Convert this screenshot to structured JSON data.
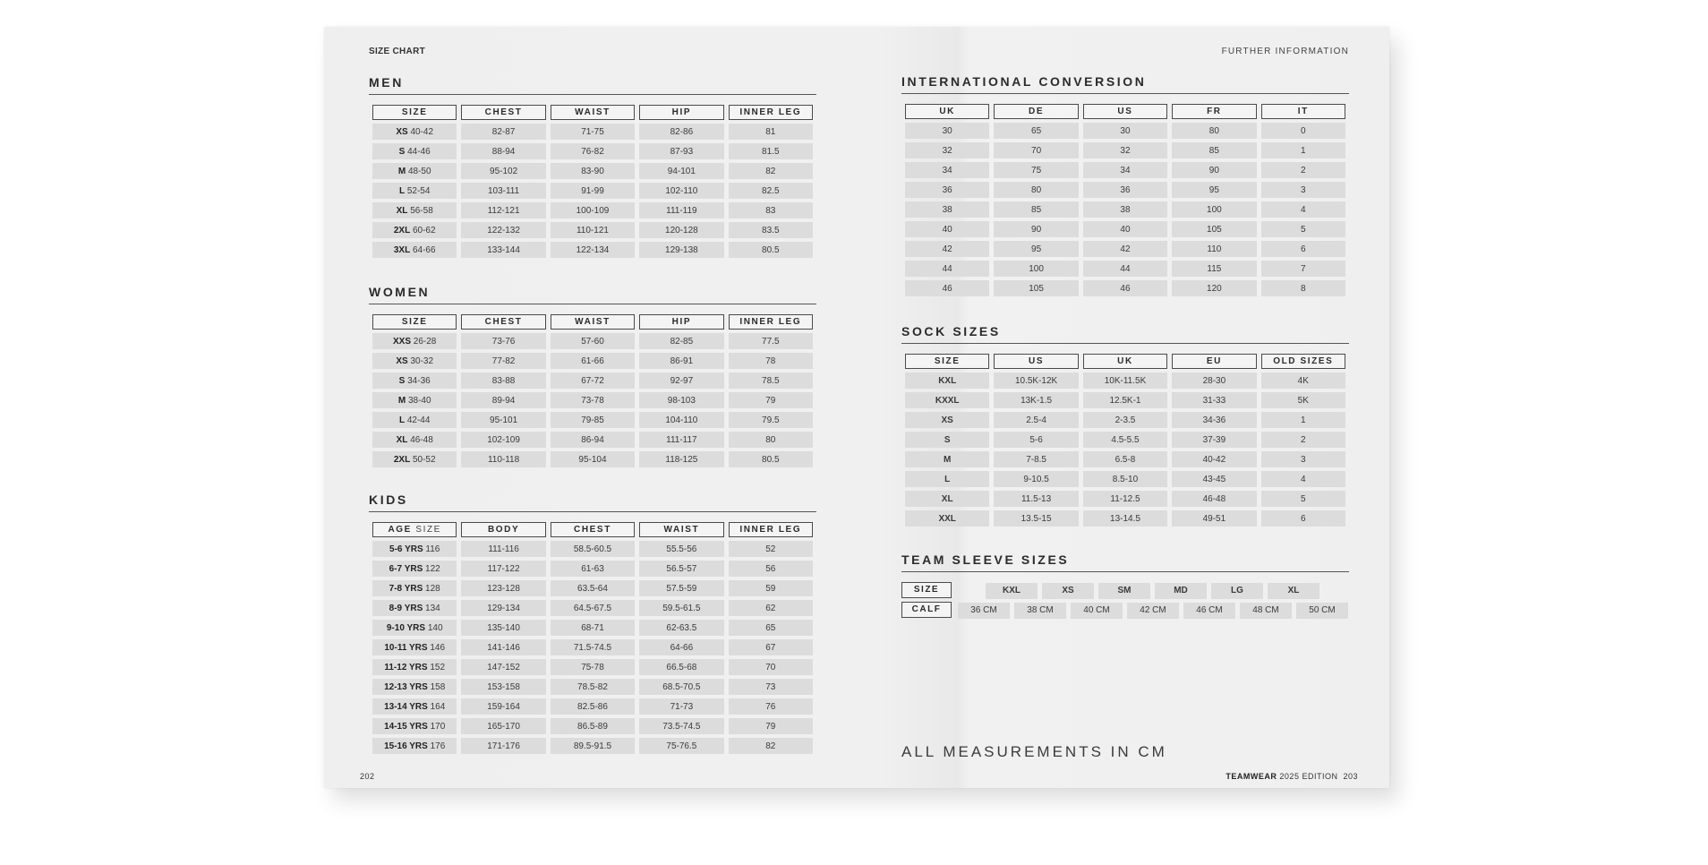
{
  "left_page": {
    "runner": "SIZE CHART",
    "folio": "202",
    "men": {
      "title": "MEN",
      "headers": [
        "SIZE",
        "CHEST",
        "WAIST",
        "HIP",
        "INNER LEG"
      ],
      "rows": [
        [
          "XS",
          "40-42",
          "82-87",
          "71-75",
          "82-86",
          "81"
        ],
        [
          "S",
          "44-46",
          "88-94",
          "76-82",
          "87-93",
          "81.5"
        ],
        [
          "M",
          "48-50",
          "95-102",
          "83-90",
          "94-101",
          "82"
        ],
        [
          "L",
          "52-54",
          "103-111",
          "91-99",
          "102-110",
          "82.5"
        ],
        [
          "XL",
          "56-58",
          "112-121",
          "100-109",
          "111-119",
          "83"
        ],
        [
          "2XL",
          "60-62",
          "122-132",
          "110-121",
          "120-128",
          "83.5"
        ],
        [
          "3XL",
          "64-66",
          "133-144",
          "122-134",
          "129-138",
          "80.5"
        ]
      ]
    },
    "women": {
      "title": "WOMEN",
      "headers": [
        "SIZE",
        "CHEST",
        "WAIST",
        "HIP",
        "INNER LEG"
      ],
      "rows": [
        [
          "XXS",
          "26-28",
          "73-76",
          "57-60",
          "82-85",
          "77.5"
        ],
        [
          "XS",
          "30-32",
          "77-82",
          "61-66",
          "86-91",
          "78"
        ],
        [
          "S",
          "34-36",
          "83-88",
          "67-72",
          "92-97",
          "78.5"
        ],
        [
          "M",
          "38-40",
          "89-94",
          "73-78",
          "98-103",
          "79"
        ],
        [
          "L",
          "42-44",
          "95-101",
          "79-85",
          "104-110",
          "79.5"
        ],
        [
          "XL",
          "46-48",
          "102-109",
          "86-94",
          "111-117",
          "80"
        ],
        [
          "2XL",
          "50-52",
          "110-118",
          "95-104",
          "118-125",
          "80.5"
        ]
      ]
    },
    "kids": {
      "title": "KIDS",
      "age_head_bold": "AGE",
      "age_head_light": "SIZE",
      "headers": [
        "BODY",
        "CHEST",
        "WAIST",
        "INNER LEG"
      ],
      "rows": [
        [
          "5-6 YRS",
          "116",
          "111-116",
          "58.5-60.5",
          "55.5-56",
          "52"
        ],
        [
          "6-7 YRS",
          "122",
          "117-122",
          "61-63",
          "56.5-57",
          "56"
        ],
        [
          "7-8 YRS",
          "128",
          "123-128",
          "63.5-64",
          "57.5-59",
          "59"
        ],
        [
          "8-9 YRS",
          "134",
          "129-134",
          "64.5-67.5",
          "59.5-61.5",
          "62"
        ],
        [
          "9-10 YRS",
          "140",
          "135-140",
          "68-71",
          "62-63.5",
          "65"
        ],
        [
          "10-11 YRS",
          "146",
          "141-146",
          "71.5-74.5",
          "64-66",
          "67"
        ],
        [
          "11-12 YRS",
          "152",
          "147-152",
          "75-78",
          "66.5-68",
          "70"
        ],
        [
          "12-13 YRS",
          "158",
          "153-158",
          "78.5-82",
          "68.5-70.5",
          "73"
        ],
        [
          "13-14 YRS",
          "164",
          "159-164",
          "82.5-86",
          "71-73",
          "76"
        ],
        [
          "14-15 YRS",
          "170",
          "165-170",
          "86.5-89",
          "73.5-74.5",
          "79"
        ],
        [
          "15-16 YRS",
          "176",
          "171-176",
          "89.5-91.5",
          "75-76.5",
          "82"
        ]
      ]
    }
  },
  "right_page": {
    "runner": "FURTHER INFORMATION",
    "folio_brand": "TEAMWEAR",
    "folio_edition": "2025 EDITION",
    "folio_page": "203",
    "footer_note": "ALL MEASUREMENTS IN CM",
    "intl": {
      "title": "INTERNATIONAL CONVERSION",
      "headers": [
        "UK",
        "DE",
        "US",
        "FR",
        "IT"
      ],
      "rows": [
        [
          "30",
          "65",
          "30",
          "80",
          "0"
        ],
        [
          "32",
          "70",
          "32",
          "85",
          "1"
        ],
        [
          "34",
          "75",
          "34",
          "90",
          "2"
        ],
        [
          "36",
          "80",
          "36",
          "95",
          "3"
        ],
        [
          "38",
          "85",
          "38",
          "100",
          "4"
        ],
        [
          "40",
          "90",
          "40",
          "105",
          "5"
        ],
        [
          "42",
          "95",
          "42",
          "110",
          "6"
        ],
        [
          "44",
          "100",
          "44",
          "115",
          "7"
        ],
        [
          "46",
          "105",
          "46",
          "120",
          "8"
        ]
      ]
    },
    "socks": {
      "title": "SOCK SIZES",
      "headers": [
        "SIZE",
        "US",
        "UK",
        "EU",
        "OLD SIZES"
      ],
      "rows": [
        [
          "KXL",
          "10.5K-12K",
          "10K-11.5K",
          "28-30",
          "4K"
        ],
        [
          "KXXL",
          "13K-1.5",
          "12.5K-1",
          "31-33",
          "5K"
        ],
        [
          "XS",
          "2.5-4",
          "2-3.5",
          "34-36",
          "1"
        ],
        [
          "S",
          "5-6",
          "4.5-5.5",
          "37-39",
          "2"
        ],
        [
          "M",
          "7-8.5",
          "6.5-8",
          "40-42",
          "3"
        ],
        [
          "L",
          "9-10.5",
          "8.5-10",
          "43-45",
          "4"
        ],
        [
          "XL",
          "11.5-13",
          "11-12.5",
          "46-48",
          "5"
        ],
        [
          "XXL",
          "13.5-15",
          "13-14.5",
          "49-51",
          "6"
        ]
      ]
    },
    "sleeve": {
      "title": "TEAM SLEEVE SIZES",
      "size_label": "SIZE",
      "calf_label": "CALF",
      "sizes": [
        "KXL",
        "XS",
        "SM",
        "MD",
        "LG",
        "XL"
      ],
      "calf": [
        "36 CM",
        "38 CM",
        "40 CM",
        "42 CM",
        "46 CM",
        "48 CM",
        "50 CM"
      ]
    }
  }
}
